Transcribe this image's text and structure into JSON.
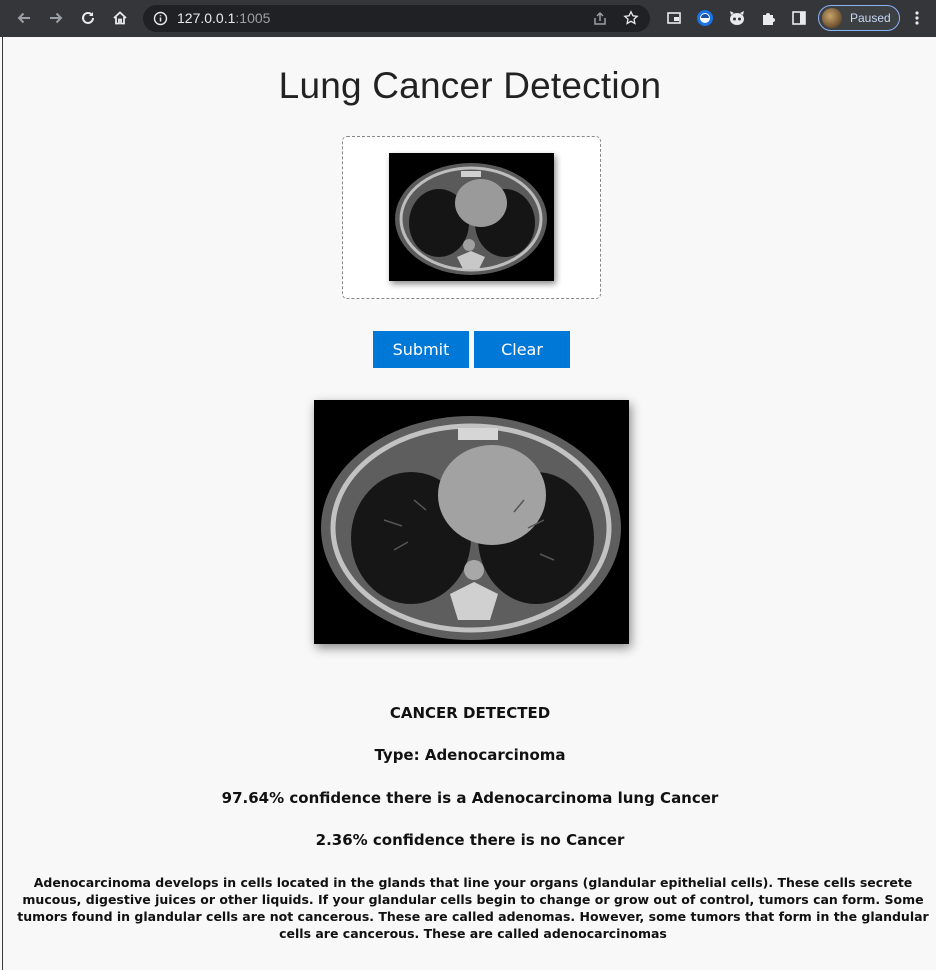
{
  "browser": {
    "url_host": "127.0.0.1",
    "url_port": ":1005",
    "profile_status": "Paused",
    "icons": [
      "back-arrow-icon",
      "forward-arrow-icon",
      "reload-icon",
      "home-icon",
      "info-icon",
      "share-icon",
      "star-icon",
      "tab-search-icon",
      "extension-icon",
      "puzzle-icon",
      "sidebar-icon",
      "menu-dots-icon"
    ]
  },
  "app": {
    "title": "Lung Cancer Detection",
    "buttons": {
      "submit": "Submit",
      "clear": "Clear"
    },
    "accent_color": "#0078d7"
  },
  "result": {
    "status": "CANCER DETECTED",
    "type": "Type: Adenocarcinoma",
    "confidence_positive": "97.64% confidence there is a Adenocarcinoma lung Cancer",
    "confidence_negative": "2.36% confidence there is no Cancer",
    "description": "Adenocarcinoma develops in cells located in the glands that line your organs (glandular epithelial cells). These cells secrete mucous, digestive juices or other liquids. If your glandular cells begin to change or grow out of control, tumors can form. Some tumors found in glandular cells are not cancerous. These are called adenomas. However, some tumors that form in the glandular cells are cancerous. These are called adenocarcinomas"
  }
}
